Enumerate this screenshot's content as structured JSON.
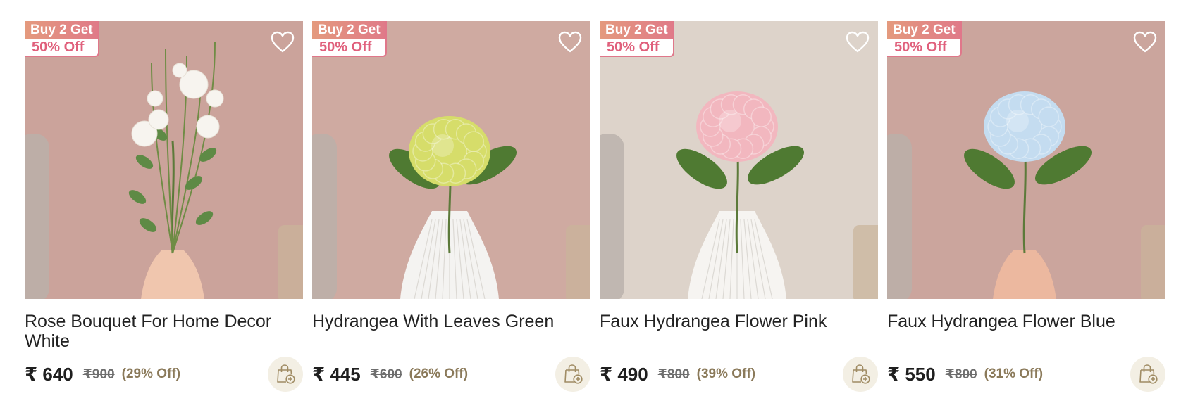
{
  "products": [
    {
      "offer_line1": "Buy 2 Get",
      "offer_line2": "50% Off",
      "title": "Rose Bouquet For Home Decor White",
      "price": "₹ 640",
      "mrp": "₹900",
      "discount": "(29% Off)",
      "wall": "#cba39b",
      "vase": "#f0c6ae",
      "flower": "#f7f4ef",
      "style": "bouquet"
    },
    {
      "offer_line1": "Buy 2 Get",
      "offer_line2": "50% Off",
      "title": "Hydrangea With Leaves Green",
      "price": "₹ 445",
      "mrp": "₹600",
      "discount": "(26% Off)",
      "wall": "#cfaaa1",
      "vase": "#f4f3f1",
      "flower": "#d6dd6a",
      "style": "hydrangea"
    },
    {
      "offer_line1": "Buy 2 Get",
      "offer_line2": "50% Off",
      "title": "Faux Hydrangea Flower Pink",
      "price": "₹ 490",
      "mrp": "₹800",
      "discount": "(39% Off)",
      "wall": "#ddd3ca",
      "vase": "#f6f4f1",
      "flower": "#f2b7bf",
      "style": "hydrangea"
    },
    {
      "offer_line1": "Buy 2 Get",
      "offer_line2": "50% Off",
      "title": "Faux Hydrangea Flower Blue",
      "price": "₹ 550",
      "mrp": "₹800",
      "discount": "(31% Off)",
      "wall": "#cba59d",
      "vase": "#ecb89f",
      "flower": "#c4dcf0",
      "style": "hydrangea"
    }
  ],
  "icons": {
    "wishlist": "heart-outline-icon",
    "cart": "shopping-bag-plus-icon"
  }
}
